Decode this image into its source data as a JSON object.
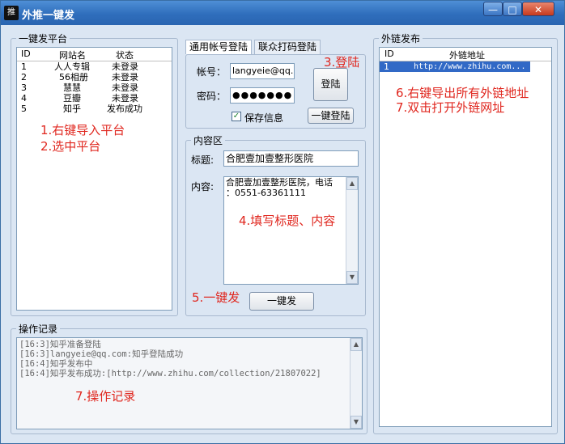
{
  "window": {
    "title": "外推一键发",
    "app_icon_text": "推",
    "minimize": "—",
    "maximize": "□",
    "close": "✕"
  },
  "platform_panel": {
    "title": "一键发平台",
    "columns": [
      "ID",
      "网站名",
      "状态"
    ],
    "rows": [
      {
        "id": "1",
        "name": "人人专辑",
        "status": "未登录"
      },
      {
        "id": "2",
        "name": "56相册",
        "status": "未登录"
      },
      {
        "id": "3",
        "name": "慧慧",
        "status": "未登录"
      },
      {
        "id": "4",
        "name": "豆瓣",
        "status": "未登录"
      },
      {
        "id": "5",
        "name": "知乎",
        "status": "发布成功"
      }
    ],
    "notes": [
      "1.右键导入平台",
      "2.选中平台"
    ]
  },
  "login_panel": {
    "tabs": [
      "通用帐号登陆",
      "联众打码登陆"
    ],
    "account_label": "帐号：",
    "account_value": "langyeie@qq.c",
    "password_label": "密码：",
    "password_value": "●●●●●●●",
    "save_info_label": "保存信息",
    "login_button": "登陆",
    "one_click_login_button": "一键登陆",
    "note": "3.登陆"
  },
  "content_panel": {
    "title": "内容区",
    "title_label": "标题:",
    "title_value": "合肥壹加壹整形医院",
    "content_label": "内容:",
    "content_value_line1": "合肥壹加壹整形医院，电话",
    "content_value_line2": "：0551-63361111",
    "note_fill": "4.填写标题、内容",
    "note_publish": "5.一键发",
    "publish_button": "一键发"
  },
  "links_panel": {
    "title": "外链发布",
    "columns": [
      "ID",
      "外链地址"
    ],
    "rows": [
      {
        "id": "1",
        "url": "http://www.zhihu.com..."
      }
    ],
    "notes": [
      "6.右键导出所有外链地址",
      "7.双击打开外链网址"
    ]
  },
  "log_panel": {
    "title": "操作记录",
    "lines": [
      "[16:3]知乎准备登陆",
      "[16:3]langyeie@qq.com:知乎登陆成功",
      "[16:4]知乎发布中",
      "[16:4]知乎发布成功:[http://www.zhihu.com/collection/21807022]"
    ],
    "note": "7.操作记录"
  },
  "colors": {
    "title_bar": "#2f6ebc",
    "annotation_red": "#e0271f",
    "window_bg": "#dbe6f3"
  }
}
